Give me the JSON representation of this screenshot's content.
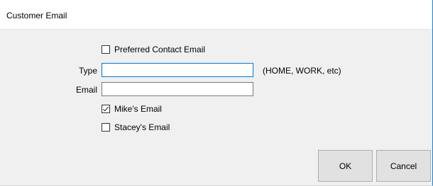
{
  "window": {
    "title": "Customer Email"
  },
  "form": {
    "preferred_contact": {
      "label": "Preferred Contact Email",
      "checked": false
    },
    "type": {
      "label": "Type",
      "value": "",
      "hint": "(HOME, WORK, etc)"
    },
    "email": {
      "label": "Email",
      "value": ""
    },
    "mikes_email": {
      "label": "Mike's Email",
      "checked": true
    },
    "staceys_email": {
      "label": "Stacey's Email",
      "checked": false
    }
  },
  "buttons": {
    "ok": "OK",
    "cancel": "Cancel"
  },
  "colors": {
    "focus_border": "#0078d7",
    "window_border_accent": "#1883d7",
    "dialog_background": "#f0f0f0",
    "button_face": "#e1e1e1"
  }
}
